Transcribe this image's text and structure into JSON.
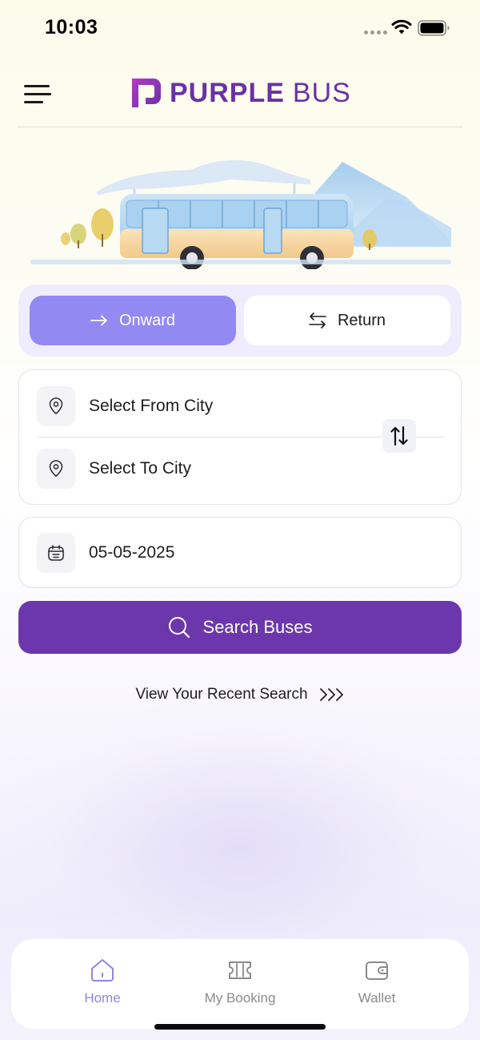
{
  "status_bar": {
    "time": "10:03",
    "icons": [
      "signal-dots-icon",
      "wifi-icon",
      "battery-icon"
    ]
  },
  "header": {
    "menu_icon": "hamburger-menu-icon",
    "logo": {
      "word1": "PURPLE",
      "word2": "BUS",
      "color": "#6a31a6"
    }
  },
  "trip_toggle": {
    "onward": {
      "label": "Onward",
      "icon": "arrow-right-icon",
      "selected": true
    },
    "return": {
      "label": "Return",
      "icon": "swap-horizontal-icon",
      "selected": false
    }
  },
  "search_form": {
    "from_city": {
      "placeholder": "Select From City",
      "icon": "location-pin-icon"
    },
    "to_city": {
      "placeholder": "Select To City",
      "icon": "location-pin-icon"
    },
    "swap_icon": "swap-vertical-icon",
    "date": {
      "value": "05-05-2025",
      "icon": "calendar-icon"
    },
    "search_button": {
      "label": "Search Buses",
      "icon": "search-icon"
    }
  },
  "recent_search": {
    "label": "View Your Recent Search",
    "icon": "triple-chevron-right-icon"
  },
  "bottom_nav": {
    "items": [
      {
        "label": "Home",
        "icon": "home-icon",
        "active": true
      },
      {
        "label": "My Booking",
        "icon": "ticket-icon",
        "active": false
      },
      {
        "label": "Wallet",
        "icon": "wallet-icon",
        "active": false
      }
    ]
  },
  "colors": {
    "accent": "#6c37ad",
    "toggle_active": "#9289f3",
    "nav_active": "#8d86e6",
    "nav_inactive": "#8a8a8e"
  }
}
